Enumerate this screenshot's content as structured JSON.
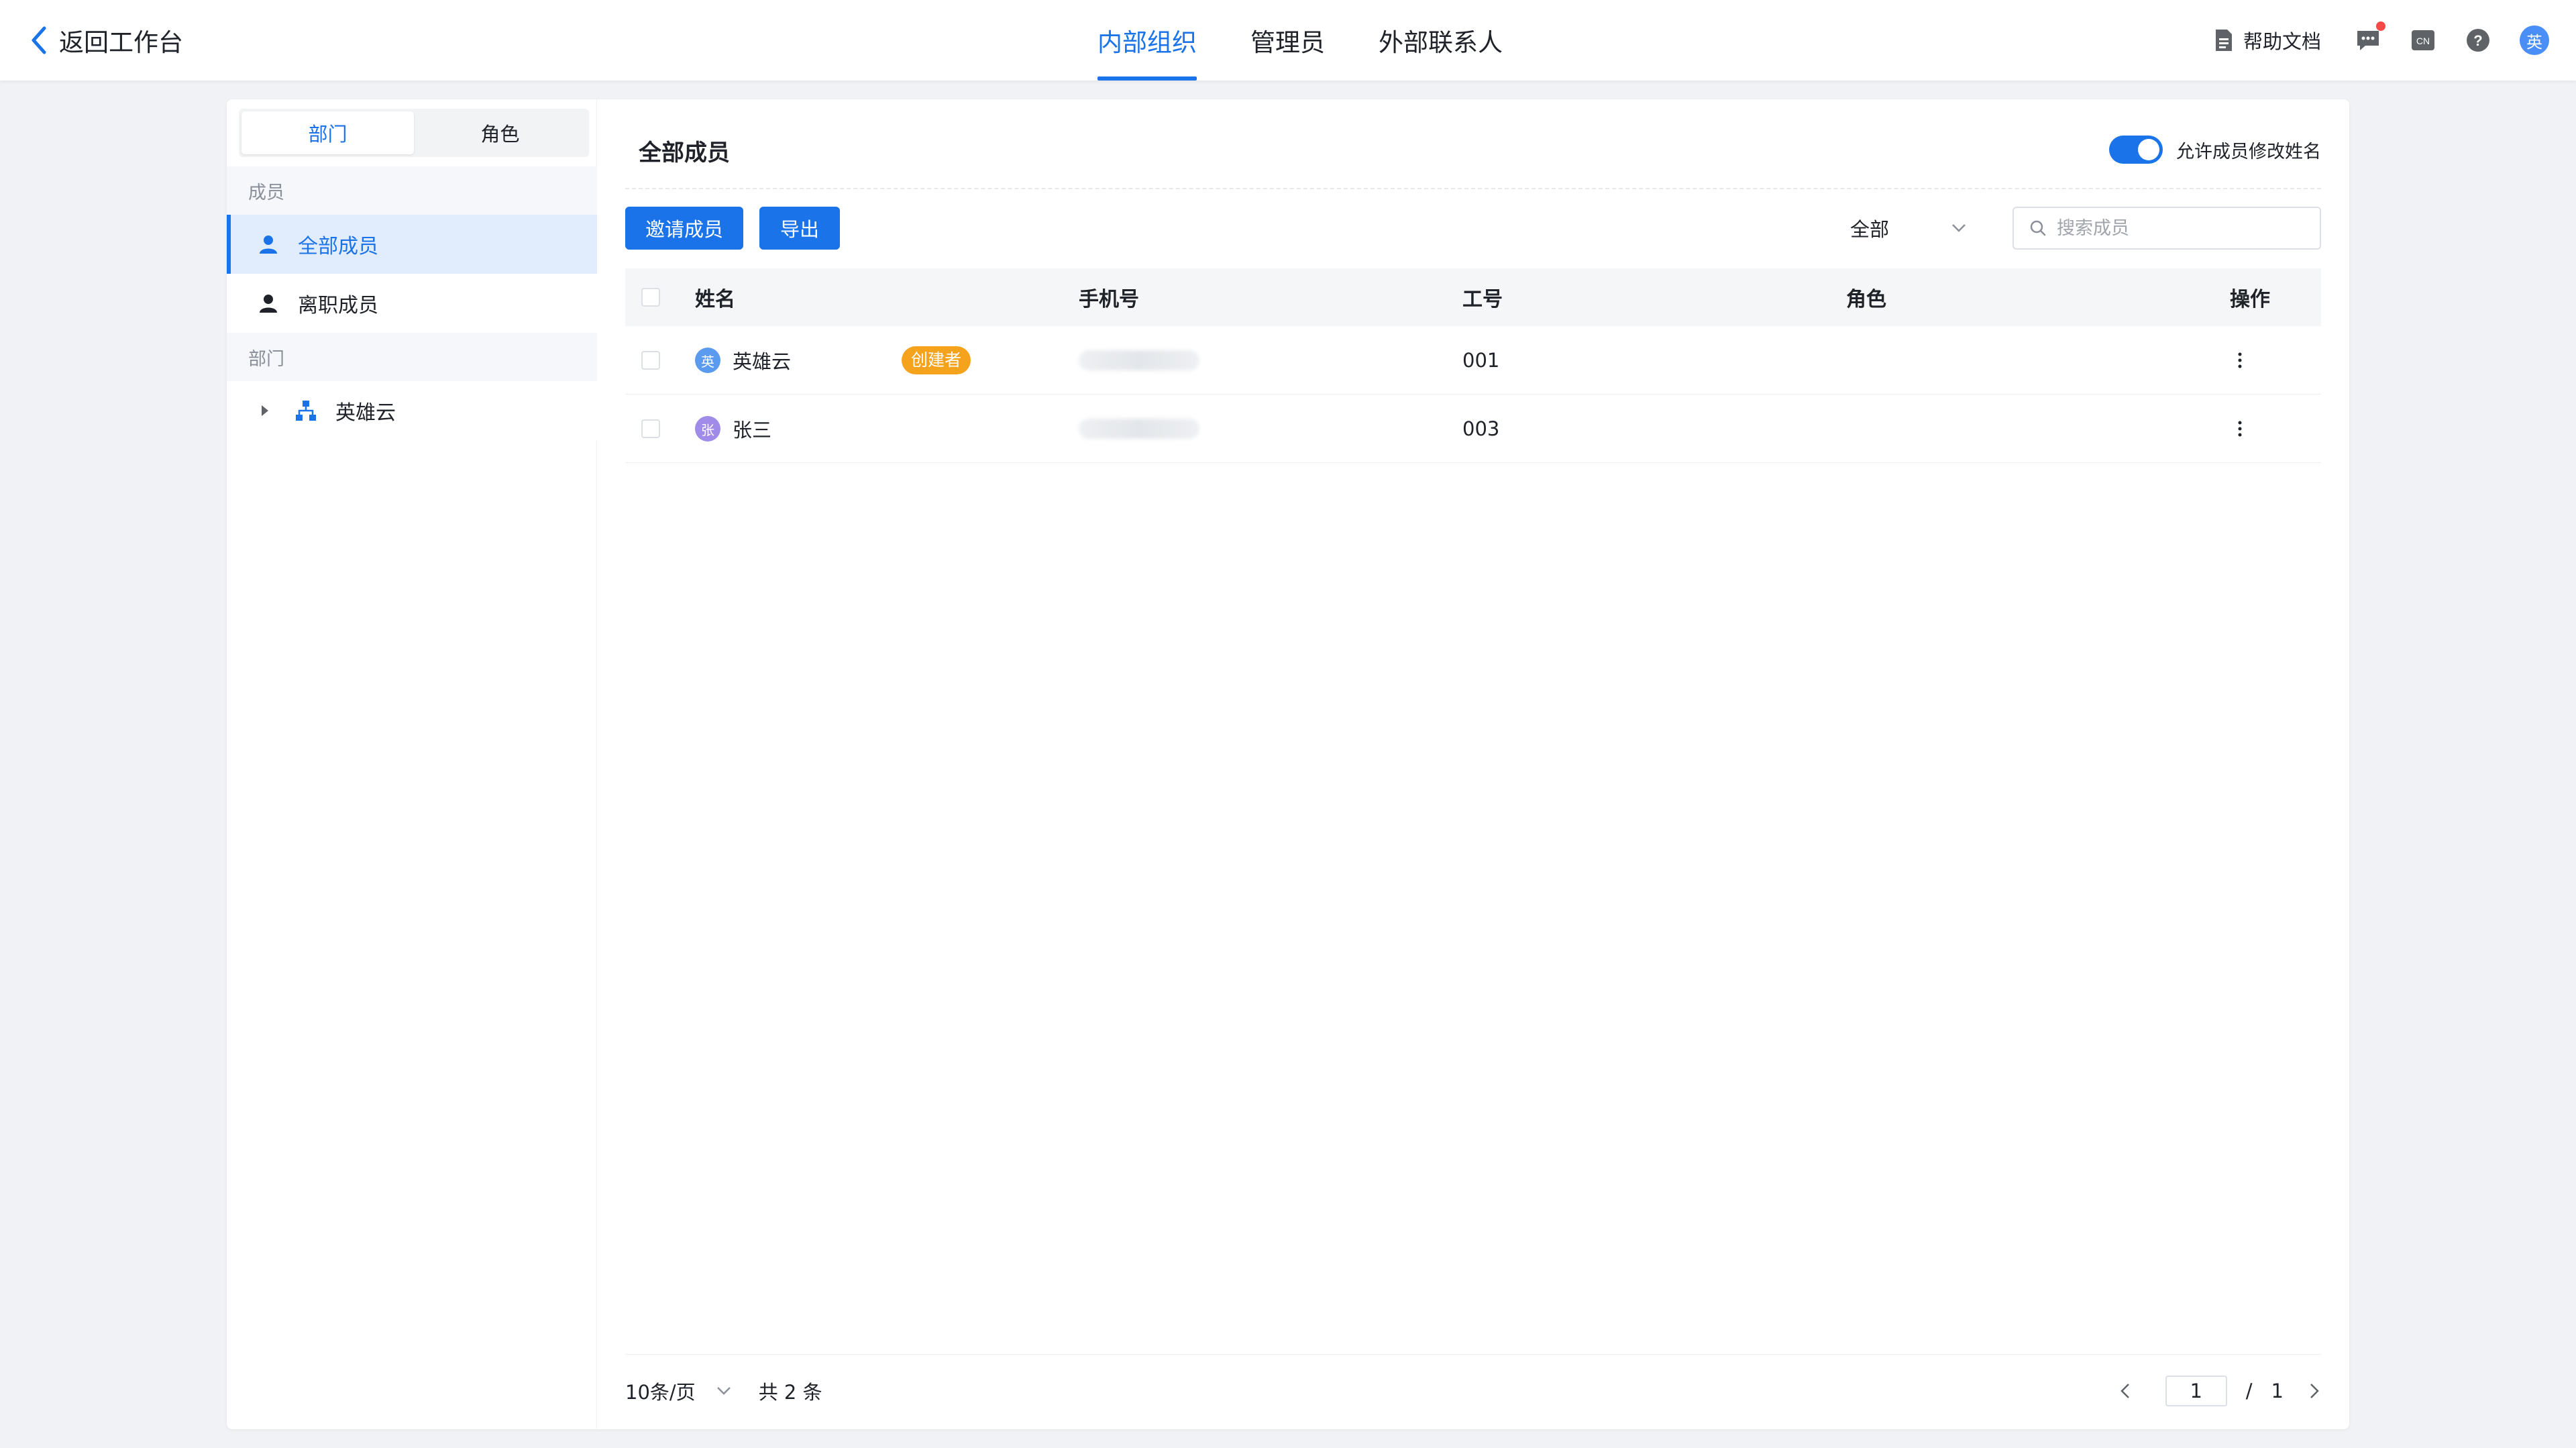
{
  "header": {
    "back_label": "返回工作台",
    "tabs": [
      {
        "label": "内部组织",
        "active": true
      },
      {
        "label": "管理员",
        "active": false
      },
      {
        "label": "外部联系人",
        "active": false
      }
    ],
    "help_label": "帮助文档",
    "lang_label": "CN",
    "avatar_label": "英",
    "accent": "#1a73e8"
  },
  "sidebar": {
    "segments": [
      {
        "label": "部门",
        "active": true
      },
      {
        "label": "角色",
        "active": false
      }
    ],
    "members_group_label": "成员",
    "member_items": [
      {
        "label": "全部成员",
        "active": true,
        "icon": "user-icon"
      },
      {
        "label": "离职成员",
        "active": false,
        "icon": "user-icon"
      }
    ],
    "dept_group_label": "部门",
    "tree": [
      {
        "label": "英雄云",
        "icon": "org-tree-icon"
      }
    ]
  },
  "main": {
    "title": "全部成员",
    "toggle_label": "允许成员修改姓名",
    "toggle_on": true,
    "invite_label": "邀请成员",
    "export_label": "导出",
    "filter_value": "全部",
    "search_placeholder": "搜索成员",
    "columns": [
      "姓名",
      "手机号",
      "工号",
      "角色",
      "操作"
    ],
    "rows": [
      {
        "avatar": "英",
        "avatar_color": "#5b9bef",
        "name": "英雄云",
        "badge": "创建者",
        "phone": "",
        "job_no": "001",
        "role": ""
      },
      {
        "avatar": "张",
        "avatar_color": "#a08be8",
        "name": "张三",
        "badge": "",
        "phone": "",
        "job_no": "003",
        "role": ""
      }
    ]
  },
  "pagination": {
    "page_size": "10条/页",
    "total": "共 2 条",
    "current_page": "1",
    "separator": "/",
    "total_pages": "1"
  }
}
